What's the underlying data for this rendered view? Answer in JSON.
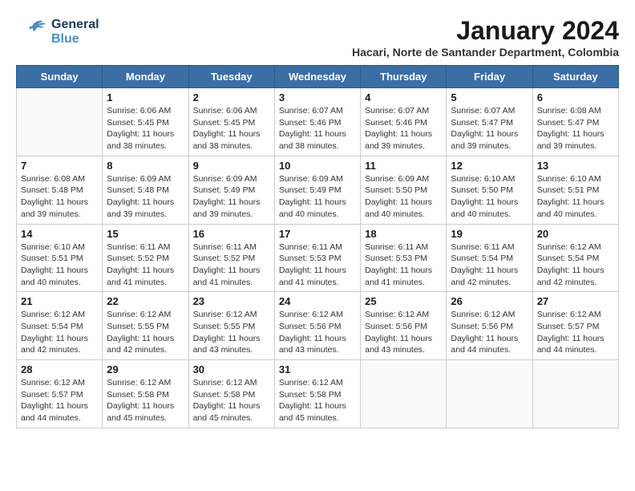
{
  "logo": {
    "general": "General",
    "blue": "Blue"
  },
  "title": "January 2024",
  "subtitle": "Hacari, Norte de Santander Department, Colombia",
  "weekdays": [
    "Sunday",
    "Monday",
    "Tuesday",
    "Wednesday",
    "Thursday",
    "Friday",
    "Saturday"
  ],
  "weeks": [
    [
      {
        "day": "",
        "sunrise": "",
        "sunset": "",
        "daylight": ""
      },
      {
        "day": "1",
        "sunrise": "Sunrise: 6:06 AM",
        "sunset": "Sunset: 5:45 PM",
        "daylight": "Daylight: 11 hours and 38 minutes."
      },
      {
        "day": "2",
        "sunrise": "Sunrise: 6:06 AM",
        "sunset": "Sunset: 5:45 PM",
        "daylight": "Daylight: 11 hours and 38 minutes."
      },
      {
        "day": "3",
        "sunrise": "Sunrise: 6:07 AM",
        "sunset": "Sunset: 5:46 PM",
        "daylight": "Daylight: 11 hours and 38 minutes."
      },
      {
        "day": "4",
        "sunrise": "Sunrise: 6:07 AM",
        "sunset": "Sunset: 5:46 PM",
        "daylight": "Daylight: 11 hours and 39 minutes."
      },
      {
        "day": "5",
        "sunrise": "Sunrise: 6:07 AM",
        "sunset": "Sunset: 5:47 PM",
        "daylight": "Daylight: 11 hours and 39 minutes."
      },
      {
        "day": "6",
        "sunrise": "Sunrise: 6:08 AM",
        "sunset": "Sunset: 5:47 PM",
        "daylight": "Daylight: 11 hours and 39 minutes."
      }
    ],
    [
      {
        "day": "7",
        "sunrise": "Sunrise: 6:08 AM",
        "sunset": "Sunset: 5:48 PM",
        "daylight": "Daylight: 11 hours and 39 minutes."
      },
      {
        "day": "8",
        "sunrise": "Sunrise: 6:09 AM",
        "sunset": "Sunset: 5:48 PM",
        "daylight": "Daylight: 11 hours and 39 minutes."
      },
      {
        "day": "9",
        "sunrise": "Sunrise: 6:09 AM",
        "sunset": "Sunset: 5:49 PM",
        "daylight": "Daylight: 11 hours and 39 minutes."
      },
      {
        "day": "10",
        "sunrise": "Sunrise: 6:09 AM",
        "sunset": "Sunset: 5:49 PM",
        "daylight": "Daylight: 11 hours and 40 minutes."
      },
      {
        "day": "11",
        "sunrise": "Sunrise: 6:09 AM",
        "sunset": "Sunset: 5:50 PM",
        "daylight": "Daylight: 11 hours and 40 minutes."
      },
      {
        "day": "12",
        "sunrise": "Sunrise: 6:10 AM",
        "sunset": "Sunset: 5:50 PM",
        "daylight": "Daylight: 11 hours and 40 minutes."
      },
      {
        "day": "13",
        "sunrise": "Sunrise: 6:10 AM",
        "sunset": "Sunset: 5:51 PM",
        "daylight": "Daylight: 11 hours and 40 minutes."
      }
    ],
    [
      {
        "day": "14",
        "sunrise": "Sunrise: 6:10 AM",
        "sunset": "Sunset: 5:51 PM",
        "daylight": "Daylight: 11 hours and 40 minutes."
      },
      {
        "day": "15",
        "sunrise": "Sunrise: 6:11 AM",
        "sunset": "Sunset: 5:52 PM",
        "daylight": "Daylight: 11 hours and 41 minutes."
      },
      {
        "day": "16",
        "sunrise": "Sunrise: 6:11 AM",
        "sunset": "Sunset: 5:52 PM",
        "daylight": "Daylight: 11 hours and 41 minutes."
      },
      {
        "day": "17",
        "sunrise": "Sunrise: 6:11 AM",
        "sunset": "Sunset: 5:53 PM",
        "daylight": "Daylight: 11 hours and 41 minutes."
      },
      {
        "day": "18",
        "sunrise": "Sunrise: 6:11 AM",
        "sunset": "Sunset: 5:53 PM",
        "daylight": "Daylight: 11 hours and 41 minutes."
      },
      {
        "day": "19",
        "sunrise": "Sunrise: 6:11 AM",
        "sunset": "Sunset: 5:54 PM",
        "daylight": "Daylight: 11 hours and 42 minutes."
      },
      {
        "day": "20",
        "sunrise": "Sunrise: 6:12 AM",
        "sunset": "Sunset: 5:54 PM",
        "daylight": "Daylight: 11 hours and 42 minutes."
      }
    ],
    [
      {
        "day": "21",
        "sunrise": "Sunrise: 6:12 AM",
        "sunset": "Sunset: 5:54 PM",
        "daylight": "Daylight: 11 hours and 42 minutes."
      },
      {
        "day": "22",
        "sunrise": "Sunrise: 6:12 AM",
        "sunset": "Sunset: 5:55 PM",
        "daylight": "Daylight: 11 hours and 42 minutes."
      },
      {
        "day": "23",
        "sunrise": "Sunrise: 6:12 AM",
        "sunset": "Sunset: 5:55 PM",
        "daylight": "Daylight: 11 hours and 43 minutes."
      },
      {
        "day": "24",
        "sunrise": "Sunrise: 6:12 AM",
        "sunset": "Sunset: 5:56 PM",
        "daylight": "Daylight: 11 hours and 43 minutes."
      },
      {
        "day": "25",
        "sunrise": "Sunrise: 6:12 AM",
        "sunset": "Sunset: 5:56 PM",
        "daylight": "Daylight: 11 hours and 43 minutes."
      },
      {
        "day": "26",
        "sunrise": "Sunrise: 6:12 AM",
        "sunset": "Sunset: 5:56 PM",
        "daylight": "Daylight: 11 hours and 44 minutes."
      },
      {
        "day": "27",
        "sunrise": "Sunrise: 6:12 AM",
        "sunset": "Sunset: 5:57 PM",
        "daylight": "Daylight: 11 hours and 44 minutes."
      }
    ],
    [
      {
        "day": "28",
        "sunrise": "Sunrise: 6:12 AM",
        "sunset": "Sunset: 5:57 PM",
        "daylight": "Daylight: 11 hours and 44 minutes."
      },
      {
        "day": "29",
        "sunrise": "Sunrise: 6:12 AM",
        "sunset": "Sunset: 5:58 PM",
        "daylight": "Daylight: 11 hours and 45 minutes."
      },
      {
        "day": "30",
        "sunrise": "Sunrise: 6:12 AM",
        "sunset": "Sunset: 5:58 PM",
        "daylight": "Daylight: 11 hours and 45 minutes."
      },
      {
        "day": "31",
        "sunrise": "Sunrise: 6:12 AM",
        "sunset": "Sunset: 5:58 PM",
        "daylight": "Daylight: 11 hours and 45 minutes."
      },
      {
        "day": "",
        "sunrise": "",
        "sunset": "",
        "daylight": ""
      },
      {
        "day": "",
        "sunrise": "",
        "sunset": "",
        "daylight": ""
      },
      {
        "day": "",
        "sunrise": "",
        "sunset": "",
        "daylight": ""
      }
    ]
  ]
}
